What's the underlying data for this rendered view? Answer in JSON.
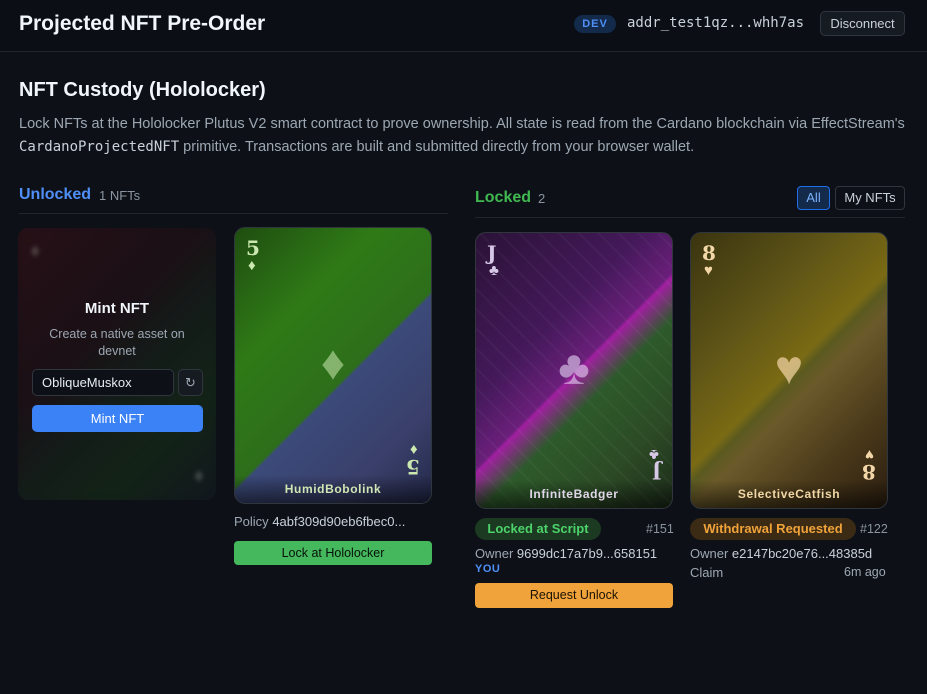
{
  "header": {
    "title": "Projected NFT Pre-Order",
    "env_badge": "DEV",
    "address": "addr_test1qz...whh7as",
    "disconnect_label": "Disconnect"
  },
  "intro": {
    "title": "NFT Custody (Hololocker)",
    "text_before": "Lock NFTs at the Hololocker Plutus V2 smart contract to prove ownership. All state is read from the Cardano blockchain via EffectStream's ",
    "code": "CardanoProjectedNFT",
    "text_after": " primitive. Transactions are built and submitted directly from your browser wallet."
  },
  "unlocked": {
    "title": "Unlocked",
    "count": "1 NFTs",
    "mint": {
      "title": "Mint NFT",
      "description": "Create a native asset on devnet",
      "input_value": "ObliqueMuskox",
      "refresh_icon": "↻",
      "button_label": "Mint NFT"
    },
    "cards": [
      {
        "rank": "5",
        "suit": "♦",
        "name": "HumidBobolink",
        "policy_label": "Policy",
        "policy_value": "4abf309d90eb6fbec0...",
        "action_label": "Lock at Hololocker",
        "action_color": "#45b85e"
      }
    ]
  },
  "locked": {
    "title": "Locked",
    "count": "2",
    "filters": [
      "All",
      "My NFTs"
    ],
    "cards": [
      {
        "rank": "J",
        "suit": "♣",
        "name": "InfiniteBadger",
        "status": "Locked at Script",
        "id": "#151",
        "owner_label": "Owner",
        "owner_value": "9699dc17a7b9...658151",
        "you_tag": "YOU",
        "action_label": "Request Unlock",
        "action_color": "#f0a33a"
      },
      {
        "rank": "8",
        "suit": "♥",
        "name": "SelectiveCatfish",
        "status": "Withdrawal Requested",
        "id": "#122",
        "owner_label": "Owner",
        "owner_value": "e2147bc20e76...48385d",
        "claim_label": "Claim",
        "time_ago": "6m ago"
      }
    ]
  },
  "colors": {
    "accent_blue": "#4f8ff7",
    "locked_green": "#3fb950",
    "withdraw_orange": "#f0a33a",
    "background": "#0d1117"
  }
}
